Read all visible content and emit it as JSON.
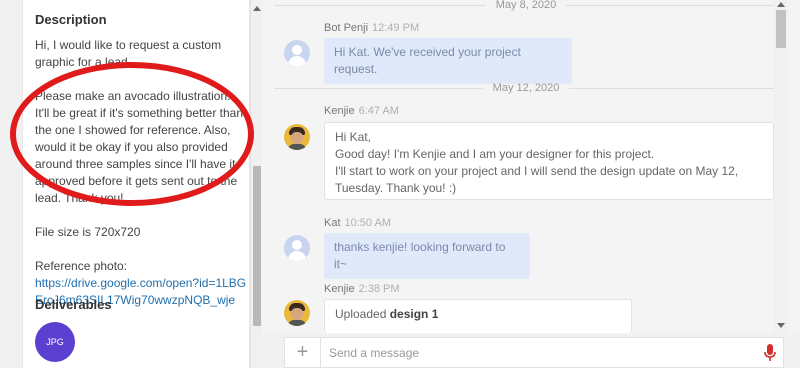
{
  "sidebar": {
    "description_title": "Description",
    "description_p1": "Hi, I would like to request a custom graphic for a lead.",
    "description_p2": "Please make an avocado illustration. It'll be great if it's something better than the one I showed for reference. Also, would it be okay if you also provided around three samples since I'll have it approved before it gets sent out to the lead. Thank you!",
    "file_size_text": "File size is 720x720",
    "reference_label": "Reference photo:",
    "reference_link": "https://drive.google.com/open?id=1LBGErcJ6m63SIL17Wig70wwzpNQB_wje",
    "deliverables_title": "Deliverables",
    "deliverable_badge": "JPG"
  },
  "chat": {
    "date_1": "May 8, 2020",
    "date_2": "May 12, 2020",
    "messages": [
      {
        "name": "Bot Penji",
        "time": "12:49 PM",
        "text": "Hi Kat. We've received your project request."
      },
      {
        "name": "Kenjie",
        "time": "6:47 AM",
        "line1": "Hi Kat,",
        "line2": "Good day! I'm Kenjie and I am your designer for this project.",
        "line3": "I'll start to work on your project and I will send the design update on May 12, Tuesday. Thank you! :)"
      },
      {
        "name": "Kat",
        "time": "10:50 AM",
        "text": "thanks kenjie! looking forward to it~"
      },
      {
        "name": "Kenjie",
        "time": "2:38 PM",
        "prefix": "Uploaded",
        "bold": "design 1"
      }
    ]
  },
  "composer": {
    "placeholder": "Send a message",
    "plus_icon": "plus-icon",
    "mic_icon": "microphone-icon"
  },
  "colors": {
    "accent_purple": "#5b3fd1",
    "annotation_red": "#e01b1b",
    "mic_red": "#d32f2f",
    "link_blue": "#1f6fb0"
  }
}
